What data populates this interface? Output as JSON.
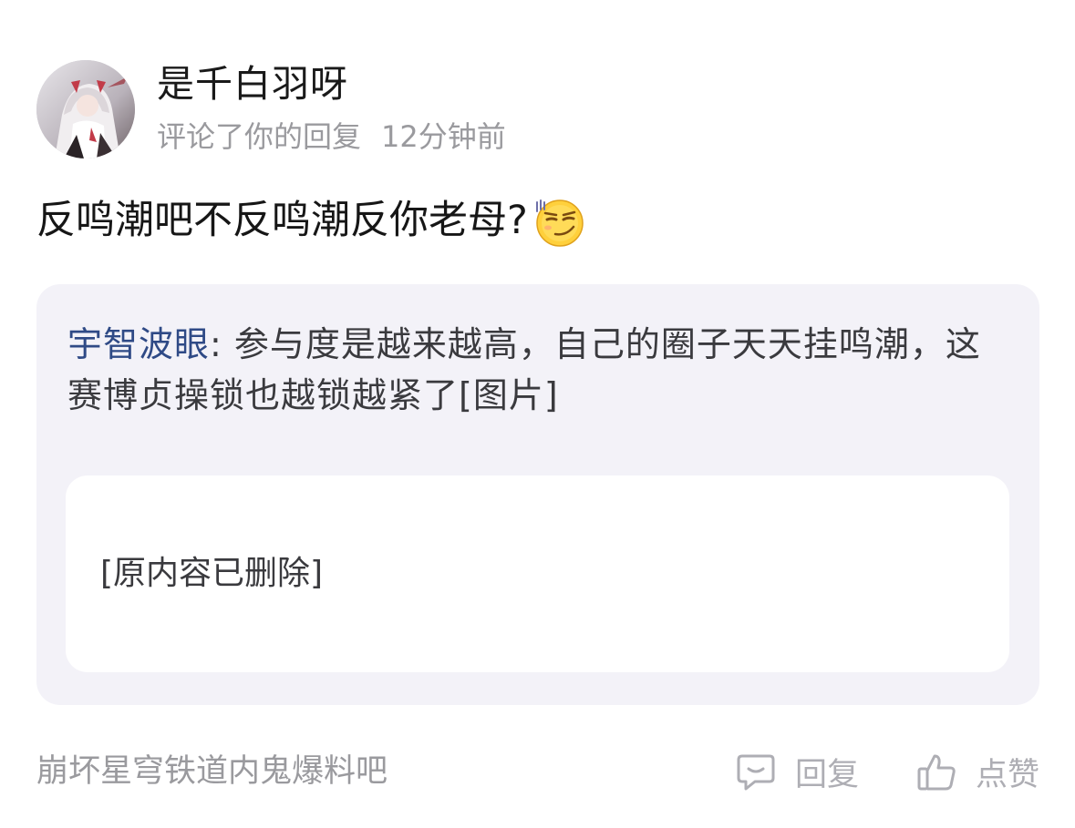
{
  "notification": {
    "user": {
      "name": "是千白羽呀",
      "avatar_icon": "anime-avatar"
    },
    "action_text": "评论了你的回复",
    "time_ago": "12分钟前",
    "comment_text": "反鸣潮吧不反鸣潮反你老母?",
    "emoji_icon": "smirk-emoji"
  },
  "quoted": {
    "author": "宇智波眼",
    "separator": ": ",
    "text": "参与度是越来越高，自己的圈子天天挂鸣潮，这赛博贞操锁也越锁越紧了[图片]",
    "deleted_content": "[原内容已删除]"
  },
  "footer": {
    "forum_name": "崩坏星穹铁道内鬼爆料吧",
    "reply_label": "回复",
    "like_label": "点赞"
  },
  "colors": {
    "author_link": "#2f4a86",
    "card_bg": "#f3f2f8",
    "muted_text": "#9a9a9e"
  }
}
